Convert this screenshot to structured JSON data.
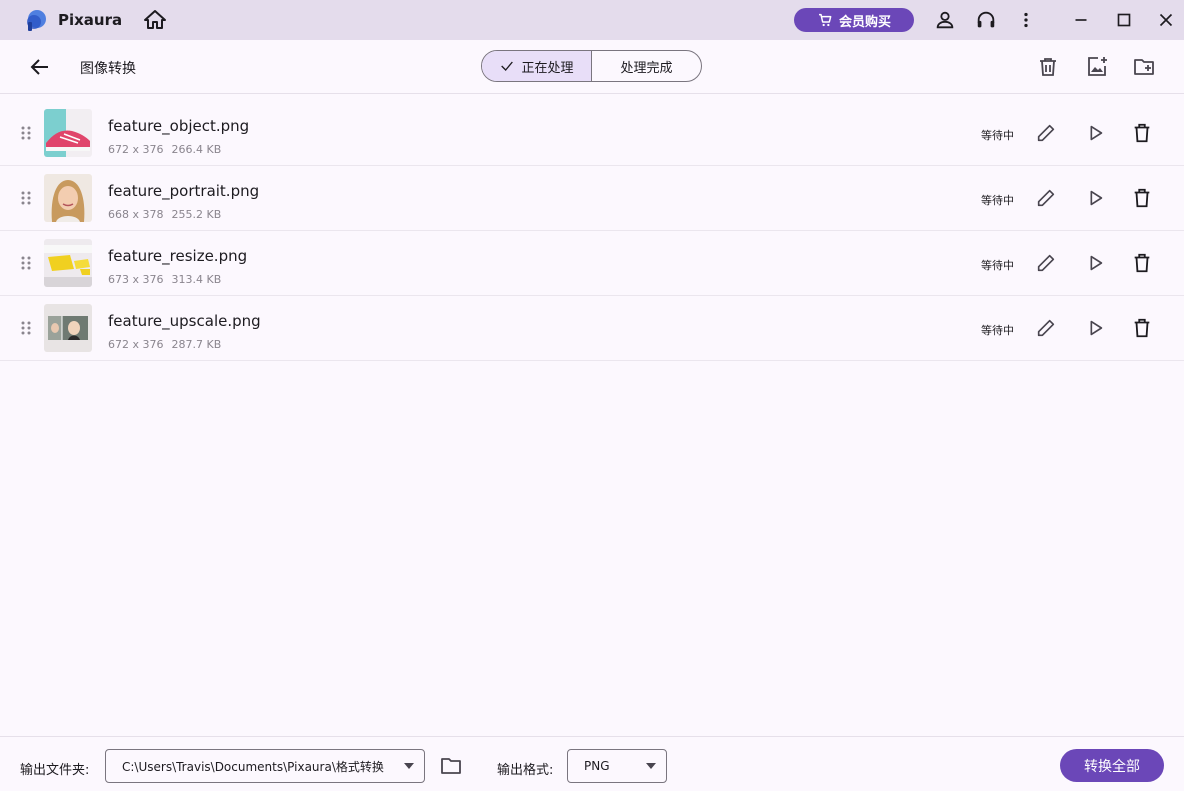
{
  "app": {
    "name": "Pixaura",
    "vip_label": "会员购买"
  },
  "toolbar": {
    "title": "图像转换",
    "tabs": [
      {
        "label": "正在处理",
        "active": true
      },
      {
        "label": "处理完成",
        "active": false
      }
    ]
  },
  "files": [
    {
      "name": "feature_object.png",
      "dims": "672 x 376",
      "size": "266.4 KB",
      "status": "等待中",
      "thumb": "shoe"
    },
    {
      "name": "feature_portrait.png",
      "dims": "668 x 378",
      "size": "255.2 KB",
      "status": "等待中",
      "thumb": "portrait"
    },
    {
      "name": "feature_resize.png",
      "dims": "673 x 376",
      "size": "313.4 KB",
      "status": "等待中",
      "thumb": "yellow-object"
    },
    {
      "name": "feature_upscale.png",
      "dims": "672 x 376",
      "size": "287.7 KB",
      "status": "等待中",
      "thumb": "photo-compare"
    }
  ],
  "footer": {
    "output_folder_label": "输出文件夹:",
    "output_folder_value": "C:\\Users\\Travis\\Documents\\Pixaura\\格式转换",
    "output_format_label": "输出格式:",
    "output_format_value": "PNG",
    "convert_all_label": "转换全部"
  },
  "colors": {
    "accent": "#6b47b8",
    "titlebar": "#e4dcec",
    "active_tab": "#e8def8",
    "background": "#fcf8fe"
  },
  "icons": [
    "home-icon",
    "cart-icon",
    "user-icon",
    "headset-icon",
    "more-vert-icon",
    "minimize-icon",
    "maximize-icon",
    "close-icon",
    "arrow-back-icon",
    "check-icon",
    "trash-icon",
    "add-image-icon",
    "add-folder-icon",
    "drag-handle-icon",
    "edit-icon",
    "play-icon",
    "delete-icon",
    "folder-icon"
  ]
}
